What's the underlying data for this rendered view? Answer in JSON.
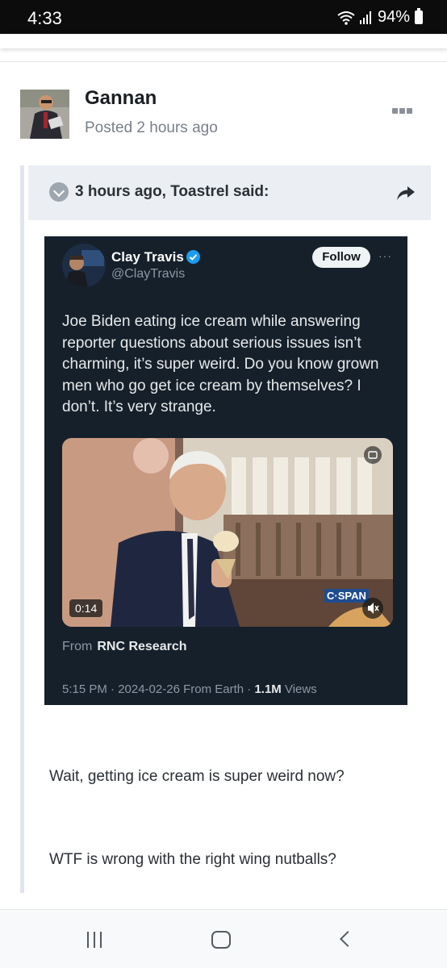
{
  "status_bar": {
    "time": "4:33",
    "battery": "94%"
  },
  "post": {
    "author": "Gannan",
    "meta": "Posted 2 hours ago",
    "quote": {
      "citation": "3 hours ago, Toastrel said:",
      "tweet": {
        "name": "Clay Travis",
        "handle": "@ClayTravis",
        "follow_label": "Follow",
        "more": "···",
        "text": "Joe Biden eating ice cream while answering reporter questions about serious issues isn’t charming, it’s super weird. Do you know grown men who go get ice cream by themselves? I don’t. It’s very strange.",
        "media": {
          "duration": "0:14",
          "watermark": "C·SPAN"
        },
        "source_prefix": "From",
        "source_name": "RNC Research",
        "stats_prefix": "5:15 PM · 2024-02-26 From Earth · ",
        "views_count": "1.1M",
        "views_label": " Views"
      },
      "replies": [
        "Wait, getting ice cream is super weird now?",
        "WTF is wrong with the right wing nutballs?"
      ]
    }
  },
  "colors": {
    "accent_verified": "#1d9bf0",
    "tweet_bg": "#15202b",
    "quote_header_bg": "#ebeff3"
  }
}
